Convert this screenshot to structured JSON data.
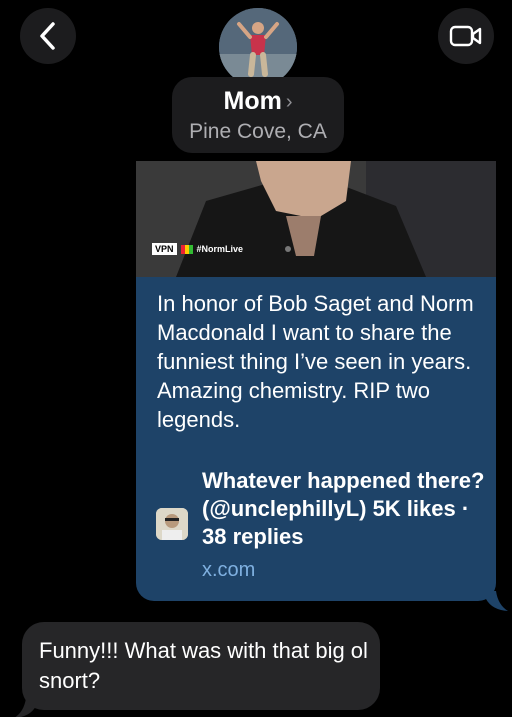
{
  "header": {
    "contact_name": "Mom",
    "contact_location": "Pine Cove, CA",
    "chevron": "›"
  },
  "icons": {
    "back": "chevron-left-icon",
    "video": "video-camera-icon"
  },
  "outgoing_message": {
    "preview_watermark": "VPN",
    "preview_hashtag": "#NormLive",
    "text": "In honor of Bob Saget and Norm Macdonald I want to share the funniest thing I’ve seen in years. Amazing chemistry. RIP two legends.",
    "card_title": "Whatever happened there? (@unclephillyL) 5K likes · 38 replies",
    "card_url": "x.com",
    "bubble_color": "#1e4368"
  },
  "incoming_message": {
    "text": "Funny!!! What was with that big ol snort?",
    "bubble_color": "#262628"
  }
}
